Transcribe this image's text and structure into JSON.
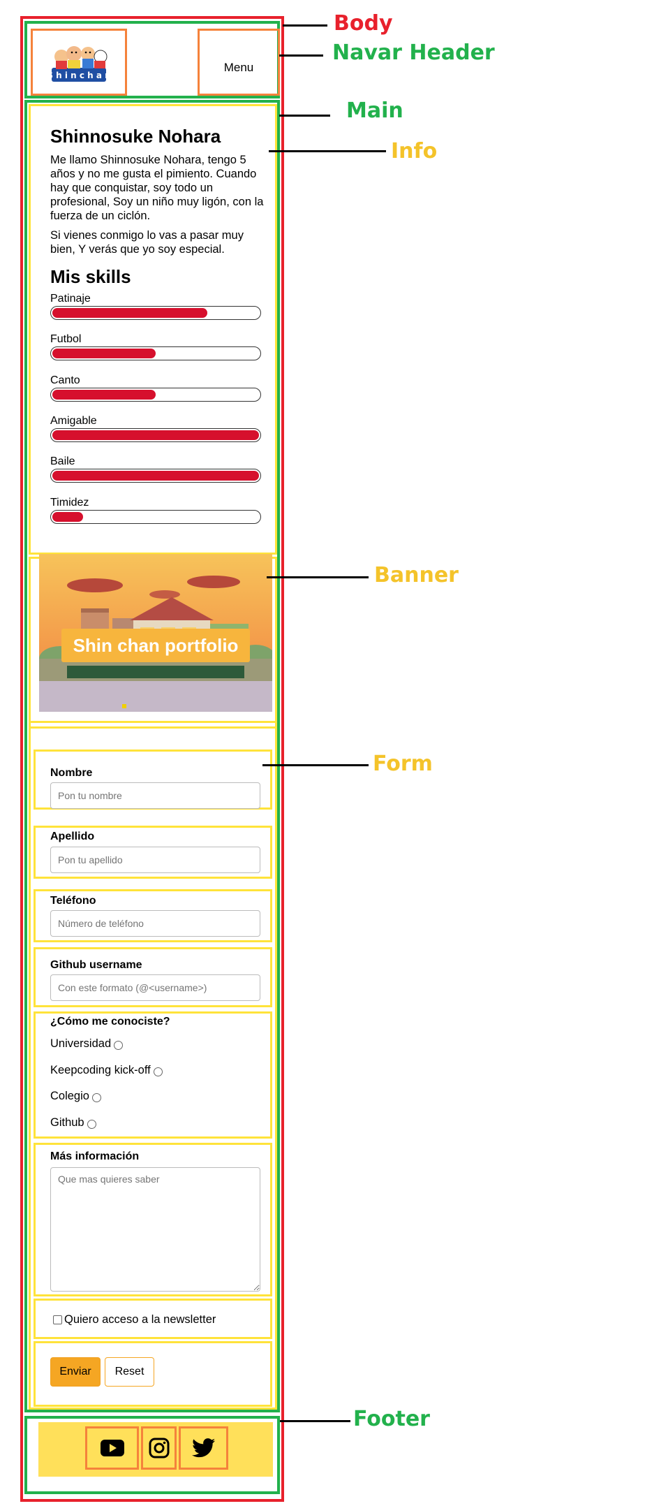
{
  "annotations": {
    "body": "Body",
    "navbar": "Navar Header",
    "main": "Main",
    "info": "Info",
    "banner": "Banner",
    "form": "Form",
    "footer": "Footer"
  },
  "header": {
    "logo_alt": "Shin chan",
    "menu_label": "Menu"
  },
  "info": {
    "name": "Shinnosuke Nohara",
    "paragraph1": "Me llamo Shinnosuke Nohara, tengo 5 años y no me gusta el pimiento. Cuando hay que conquistar, soy todo un profesional, Soy un niño muy ligón, con la fuerza de un ciclón.",
    "paragraph2": "Si vienes conmigo lo vas a pasar muy bien, Y verás que yo soy especial.",
    "skills_title": "Mis skills",
    "skills": [
      {
        "label": "Patinaje",
        "level": 0.75
      },
      {
        "label": "Futbol",
        "level": 0.5
      },
      {
        "label": "Canto",
        "level": 0.5
      },
      {
        "label": "Amigable",
        "level": 1.0
      },
      {
        "label": "Baile",
        "level": 1.0
      },
      {
        "label": "Timidez",
        "level": 0.15
      }
    ]
  },
  "banner": {
    "caption": "Shin chan portfolio"
  },
  "form": {
    "nombre_label": "Nombre",
    "nombre_placeholder": "Pon tu nombre",
    "apellido_label": "Apellido",
    "apellido_placeholder": "Pon tu apellido",
    "telefono_label": "Teléfono",
    "telefono_placeholder": "Número de teléfono",
    "github_label": "Github username",
    "github_placeholder": "Con este formato (@<username>)",
    "como_label": "¿Cómo me conociste?",
    "radios": [
      "Universidad",
      "Keepcoding kick-off",
      "Colegio",
      "Github"
    ],
    "mas_label": "Más información",
    "mas_placeholder": "Que mas quieres saber",
    "newsletter_label": "Quiero acceso a la newsletter",
    "send_label": "Enviar",
    "reset_label": "Reset"
  },
  "colors": {
    "body_outline": "#e8212c",
    "section_outline": "#22b14c",
    "block_outline": "#ffe33a",
    "element_outline": "#f5823b",
    "skill_fill": "#d6102d",
    "footer_band": "#ffe05a",
    "primary_button": "#f5a623"
  },
  "footer": {
    "icons": [
      "youtube-icon",
      "instagram-icon",
      "twitter-icon"
    ]
  }
}
